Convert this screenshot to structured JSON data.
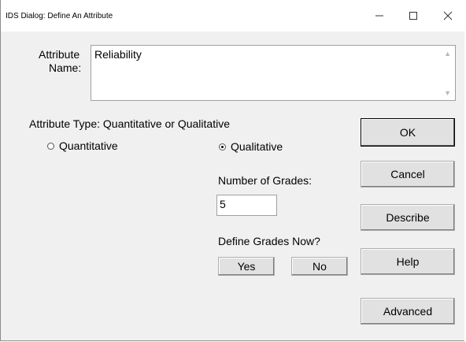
{
  "window": {
    "title": "IDS Dialog: Define An Attribute"
  },
  "attribute_name": {
    "label_line1": "Attribute",
    "label_line2": "Name:",
    "value": "Reliability"
  },
  "attribute_type": {
    "label": "Attribute Type:  Quantitative or Qualitative",
    "options": [
      {
        "label": "Quantitative",
        "selected": false
      },
      {
        "label": "Qualitative",
        "selected": true
      }
    ]
  },
  "grades": {
    "label": "Number of Grades:",
    "value": "5",
    "define_label": "Define Grades Now?",
    "yes_label": "Yes",
    "no_label": "No"
  },
  "buttons": {
    "ok": "OK",
    "cancel": "Cancel",
    "describe": "Describe",
    "help": "Help",
    "advanced": "Advanced"
  }
}
